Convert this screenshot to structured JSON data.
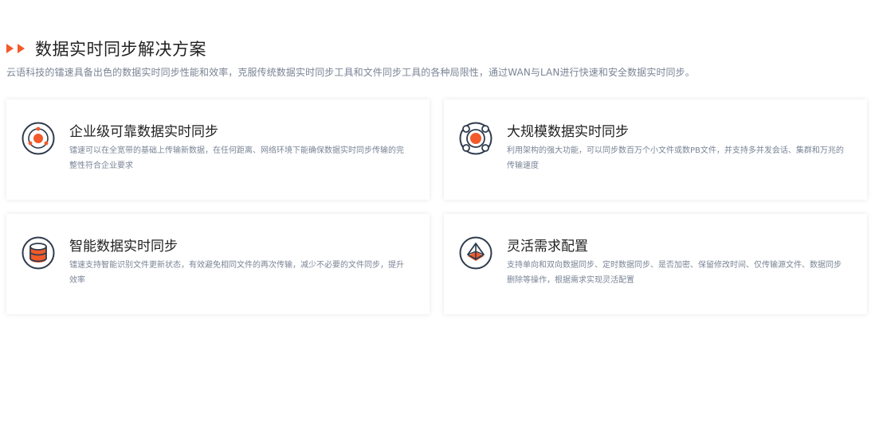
{
  "section": {
    "title": "数据实时同步解决方案",
    "subtitle": "云语科技的镭速具备出色的数据实时同步性能和效率，克服传统数据实时同步工具和文件同步工具的各种局限性，通过WAN与LAN进行快速和安全数据实时同步。"
  },
  "colors": {
    "accent": "#f25a2a",
    "icon_stroke": "#2f3b4d",
    "text_muted": "#7a8596"
  },
  "cards": [
    {
      "icon": "target-orbit-icon",
      "title": "企业级可靠数据实时同步",
      "desc": "镭速可以在全宽带的基础上传输新数据，在任何距离、网络环境下能确保数据实时同步传输的完整性符合企业要求"
    },
    {
      "icon": "network-nodes-icon",
      "title": "大规模数据实时同步",
      "desc": "利用架构的强大功能，可以同步数百万个小文件或数PB文件，并支持多并发会话、集群和万兆的传输速度"
    },
    {
      "icon": "database-icon",
      "title": "智能数据实时同步",
      "desc": "镭速支持智能识别文件更新状态，有效避免相同文件的再次传输，减少不必要的文件同步，提升效率"
    },
    {
      "icon": "pyramid-layers-icon",
      "title": "灵活需求配置",
      "desc": "支持单向和双向数据同步、定时数据同步、是否加密、保留修改时间、仅传输源文件、数据同步删除等操作，根据需求实现灵活配置"
    }
  ]
}
